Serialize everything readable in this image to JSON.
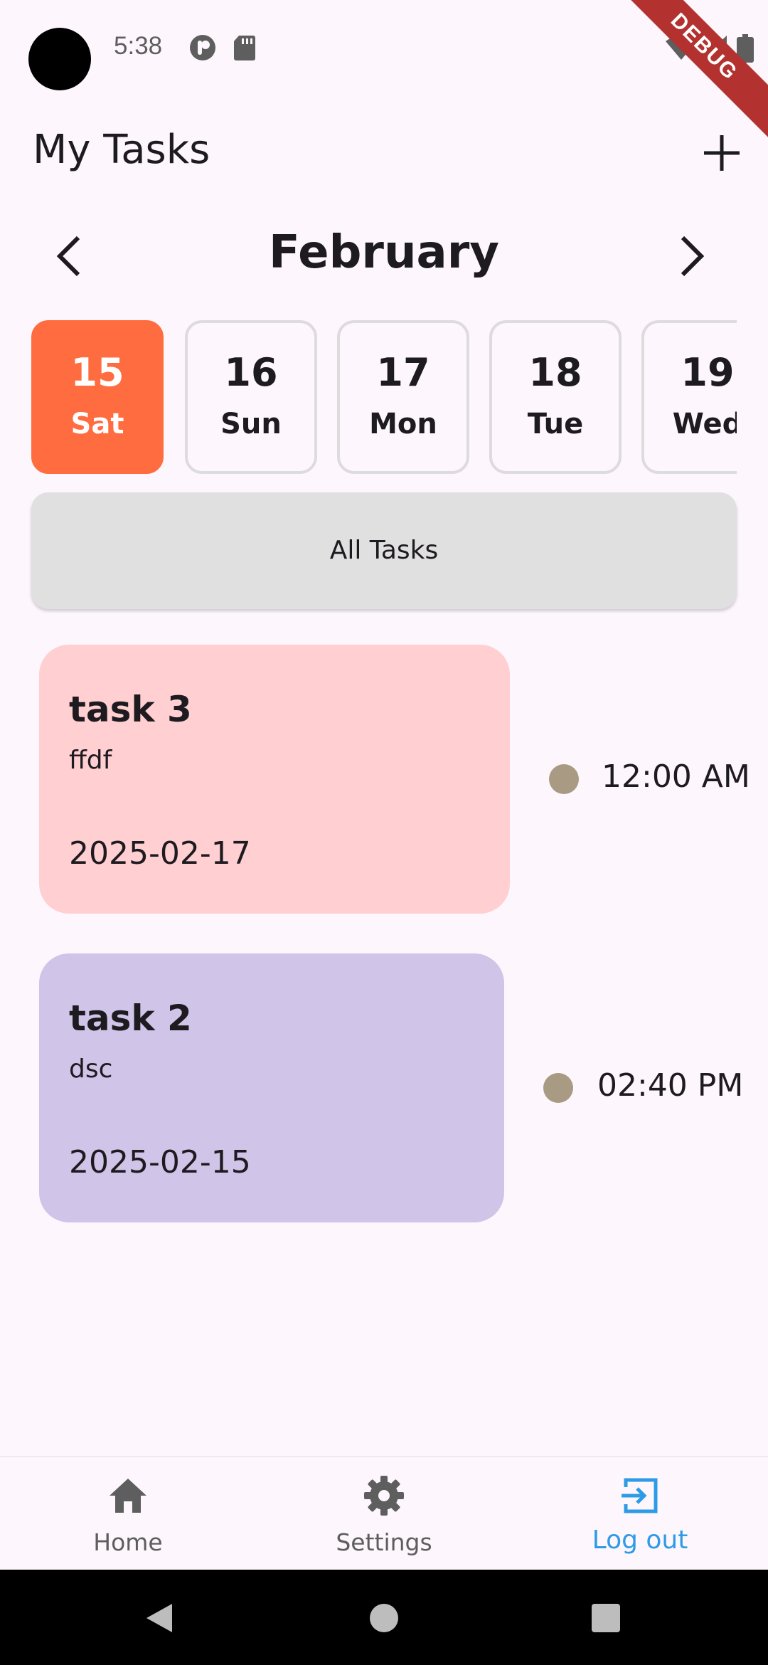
{
  "status_bar": {
    "time": "5:38",
    "icons": [
      "podcast-icon",
      "sd-card-icon",
      "wifi-icon",
      "signal-icon",
      "battery-icon"
    ],
    "debug_label": "DEBUG"
  },
  "header": {
    "title": "My Tasks",
    "add_icon": "plus-icon"
  },
  "month_nav": {
    "month": "February",
    "prev_icon": "chevron-left-icon",
    "next_icon": "chevron-right-icon"
  },
  "days": [
    {
      "num": "15",
      "name": "Sat",
      "selected": true
    },
    {
      "num": "16",
      "name": "Sun",
      "selected": false
    },
    {
      "num": "17",
      "name": "Mon",
      "selected": false
    },
    {
      "num": "18",
      "name": "Tue",
      "selected": false
    },
    {
      "num": "19",
      "name": "Wed",
      "selected": false
    }
  ],
  "all_tasks_label": "All Tasks",
  "tasks": [
    {
      "title": "task 3",
      "description": "ffdf",
      "date": "2025-02-17",
      "time": "12:00 AM",
      "color": "#FFCFD2"
    },
    {
      "title": "task 2",
      "description": "dsc",
      "date": "2025-02-15",
      "time": "02:40 PM",
      "color": "#D0C4E8"
    }
  ],
  "bottom_nav": {
    "items": [
      {
        "label": "Home",
        "icon": "home-icon",
        "active": false
      },
      {
        "label": "Settings",
        "icon": "gear-icon",
        "active": false
      },
      {
        "label": "Log out",
        "icon": "logout-icon",
        "active": true
      }
    ]
  },
  "colors": {
    "accent": "#FF6C3F",
    "active_nav": "#2E9BE6",
    "time_dot": "#A99A84",
    "background": "#FDF7FD"
  }
}
